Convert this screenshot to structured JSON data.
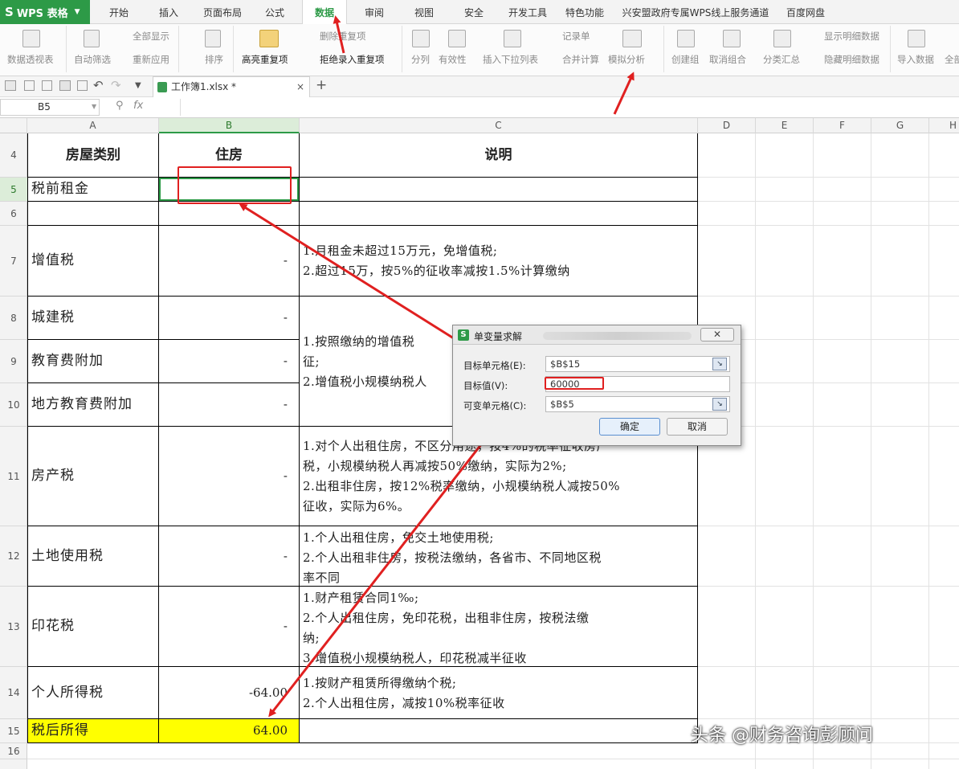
{
  "app": {
    "name": "WPS 表格",
    "logo_glyph": "S",
    "brand_color": "#2d9a47"
  },
  "tabs": [
    {
      "label": "开始"
    },
    {
      "label": "插入"
    },
    {
      "label": "页面布局"
    },
    {
      "label": "公式"
    },
    {
      "label": "数据",
      "active": true
    },
    {
      "label": "审阅"
    },
    {
      "label": "视图"
    },
    {
      "label": "安全"
    },
    {
      "label": "开发工具"
    },
    {
      "label": "特色功能"
    },
    {
      "label": "兴安盟政府专属WPS线上服务通道"
    },
    {
      "label": "百度网盘"
    }
  ],
  "ribbon": {
    "pivot": "数据透视表",
    "autofilter": "自动筛选",
    "show_all": "全部显示",
    "reapply": "重新应用",
    "sort": "排序",
    "highlight_dup": "高亮重复项",
    "delete_dup": "删除重复项",
    "reject_dup": "拒绝录入重复项",
    "split": "分列",
    "validity": "有效性",
    "dropdown_list": "插入下拉列表",
    "records": "记录单",
    "consolidate": "合并计算",
    "what_if": "模拟分析",
    "create_group": "创建组",
    "ungroup": "取消组合",
    "subtotal": "分类汇总",
    "show_detail": "显示明细数据",
    "hide_detail": "隐藏明细数据",
    "import_data": "导入数据",
    "all": "全部"
  },
  "document": {
    "tab_title": "工作簿1.xlsx *",
    "close_glyph": "×",
    "new_glyph": "+"
  },
  "formula_bar": {
    "cell_ref": "B5",
    "fx": "fx",
    "content": ""
  },
  "columns": [
    "A",
    "B",
    "C",
    "D",
    "E",
    "F",
    "G",
    "H"
  ],
  "rows": [
    "4",
    "5",
    "6",
    "7",
    "8",
    "9",
    "10",
    "11",
    "12",
    "13",
    "14",
    "15",
    "16"
  ],
  "sheet": {
    "header": {
      "category": "房屋类别",
      "housing": "住房",
      "notes": "说明"
    },
    "r5": {
      "label": "税前租金",
      "value": ""
    },
    "r7": {
      "label": "增值税",
      "value": "-",
      "note1": "1.月租金未超过15万元，免增值税;",
      "note2": "2.超过15万，按5%的征收率减按1.5%计算缴纳"
    },
    "r8": {
      "label": "城建税",
      "value": "-"
    },
    "r9": {
      "label": "教育费附加",
      "value": "-"
    },
    "r10": {
      "label": "地方教育费附加",
      "value": "-"
    },
    "r8_10_note": {
      "l1": "1.按照缴纳的增值税",
      "l2": "征;",
      "l3": "2.增值税小规模纳税人"
    },
    "r11": {
      "label": "房产税",
      "value": "-",
      "l1": "1.对个人出租住房，不区分用途，按4%的税率征收房产",
      "l2": "税，小规模纳税人再减按50%缴纳，实际为2%;",
      "l3": "2.出租非住房，按12%税率缴纳，小规模纳税人减按50%",
      "l4": "征收，实际为6%。"
    },
    "r12": {
      "label": "土地使用税",
      "value": "-",
      "l1": "1.个人出租住房，免交土地使用税;",
      "l2": "2.个人出租非住房，按税法缴纳，各省市、不同地区税",
      "l3": "率不同"
    },
    "r13": {
      "label": "印花税",
      "value": "-",
      "l1": "1.财产租赁合同1‰;",
      "l2": "2.个人出租住房，免印花税，出租非住房，按税法缴",
      "l3": "纳;",
      "l4": "3.增值税小规模纳税人，印花税减半征收"
    },
    "r14": {
      "label": "个人所得税",
      "value": "-64.00",
      "l1": "1.按财产租赁所得缴纳个税;",
      "l2": "2.个人出租住房，减按10%税率征收"
    },
    "r15": {
      "label": "税后所得",
      "value": "64.00"
    },
    "highlight_color": "#ffff00"
  },
  "dialog": {
    "title": "单变量求解",
    "target_cell_label": "目标单元格(E):",
    "target_cell_value": "$B$15",
    "target_value_label": "目标值(V):",
    "target_value": "60000",
    "changing_cell_label": "可变单元格(C):",
    "changing_cell_value": "$B$5",
    "ok_label": "确定",
    "cancel_label": "取消"
  },
  "annotation_color": "#e02020",
  "watermark": "头条 @财务咨询彭顾问"
}
